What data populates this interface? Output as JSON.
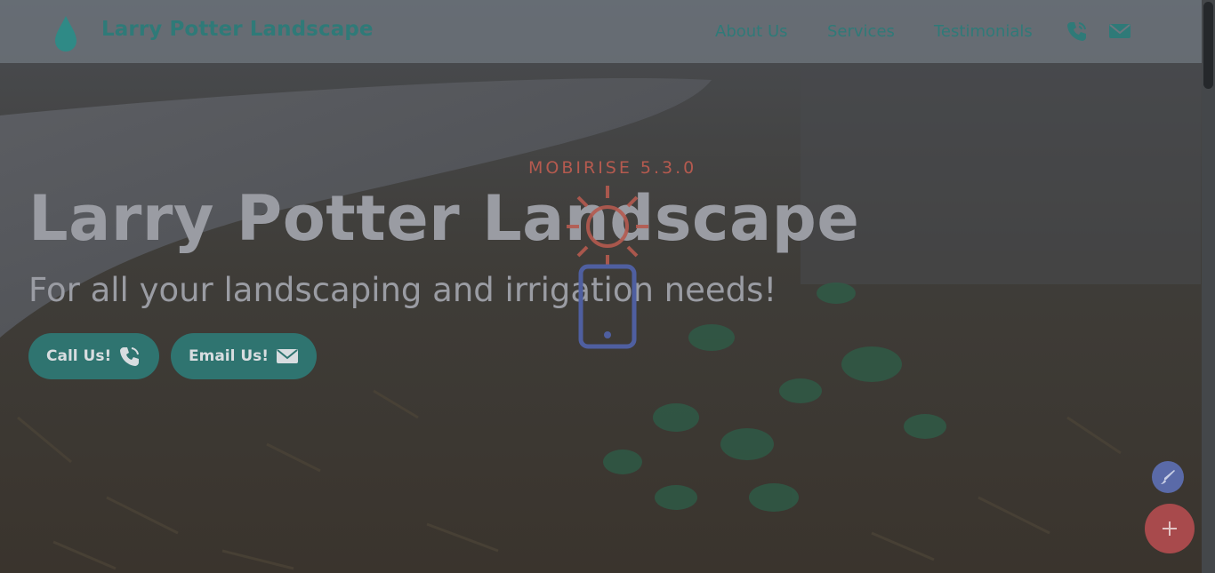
{
  "navbar": {
    "brand": "Larry Potter Landscape",
    "links": [
      "About Us",
      "Services",
      "Testimonials"
    ],
    "icons": [
      "phone-icon",
      "mail-icon"
    ]
  },
  "hero": {
    "badge": "MOBIRISE 5.3.0",
    "title": "Larry Potter Landscape",
    "subtitle": "For all your landscaping and irrigation needs!",
    "buttons": [
      {
        "label": "Call Us!",
        "icon": "phone-icon"
      },
      {
        "label": "Email Us!",
        "icon": "mail-icon"
      }
    ]
  },
  "floating": {
    "edit_icon": "brush-icon",
    "add_icon": "plus-icon"
  },
  "colors": {
    "accent": "#2f7a78",
    "button": "#2f7470",
    "badge": "#b55a4f",
    "fab_add": "#a84a4c",
    "fab_edit": "#5a6aa8"
  }
}
